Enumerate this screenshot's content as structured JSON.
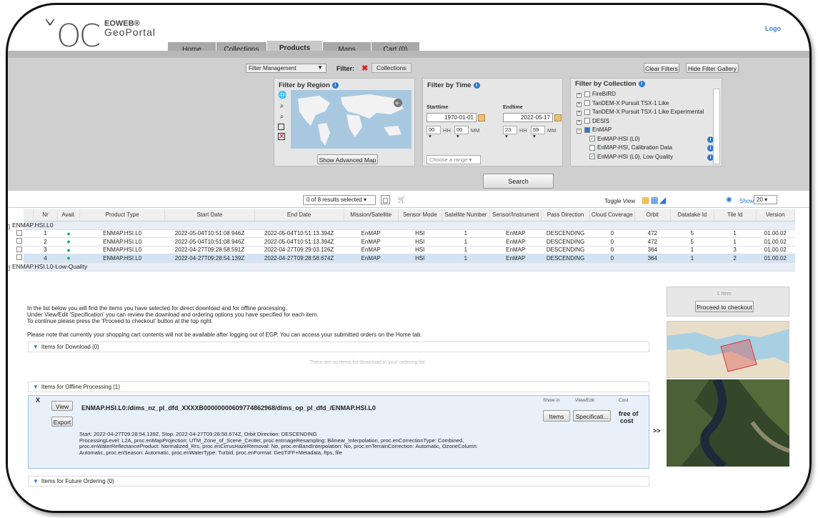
{
  "header": {
    "logo_mark": "OC",
    "logo_line1": "EOWEB®",
    "logo_line2": "GeoPortal",
    "login": "Logo"
  },
  "tabs": [
    "Home",
    "Collections",
    "Products",
    "Maps",
    "Cart (0)"
  ],
  "filter_bar": {
    "management": "Filter Management",
    "filter_label": "Filter:",
    "collections_btn": "Collections",
    "clear_filters": "Clear Filters",
    "hide_gallery": "Hide Filter Gallery"
  },
  "region": {
    "title": "Filter by Region",
    "adv_map": "Show Advanced Map"
  },
  "time": {
    "title": "Filter by Time",
    "start_label": "Starttime",
    "start_date": "1970-01-01",
    "end_label": "Endtime",
    "end_date": "2022-05-17",
    "start_h": "00",
    "start_m": "00",
    "end_h": "23",
    "end_m": "59",
    "hh": "HH",
    "mm": "MM",
    "range_placeholder": "Choose a range"
  },
  "collection": {
    "title": "Filter by Collection",
    "items": [
      {
        "label": "FireBIRD",
        "type": "plus"
      },
      {
        "label": "TanDEM-X Pursuit TSX-1 Like",
        "type": "plus"
      },
      {
        "label": "TanDEM-X Pursuit TSX-1 Like Experimental",
        "type": "plus"
      },
      {
        "label": "DESIS",
        "type": "plus"
      },
      {
        "label": "EnMAP",
        "type": "minus"
      },
      {
        "label": "EnMAP-HSI (L0)",
        "type": "checked"
      },
      {
        "label": "EnMAP-HSI, Calibration Data",
        "type": "unchecked"
      },
      {
        "label": "EnMAP-HSI (L0), Low Quality",
        "type": "checked"
      }
    ]
  },
  "search_btn": "Search",
  "results_bar": {
    "selected": "0 of 8 results selected",
    "toggle_view": "Toggle View",
    "show_items": "Show items :",
    "show_items_val": "20"
  },
  "table": {
    "headers": [
      "Nr",
      "Avail.",
      "Product Type",
      "Start Date",
      "End Date",
      "Mission/Satellite",
      "Sensor Mode",
      "Satellite Number",
      "Sensor/Instrument",
      "Pass Direction",
      "Cloud Coverage",
      "Orbit",
      "Datatake Id",
      "Tile Id",
      "Version"
    ],
    "group1": "ENMAP.HSI.L0",
    "group2": "ENMAP.HSI.L0-Low-Quality",
    "rows": [
      [
        "1",
        "ENMAP.HSI.L0",
        "2022-05-04T10:51:08.946Z",
        "2022-05-04T10:51:13.394Z",
        "EnMAP",
        "HSI",
        "1",
        "EnMAP",
        "DESCENDING",
        "0",
        "472",
        "5",
        "1",
        "01.00.02"
      ],
      [
        "2",
        "ENMAP.HSI.L0",
        "2022-05-04T10:51:08.946Z",
        "2022-05-04T10:51:13.394Z",
        "EnMAP",
        "HSI",
        "1",
        "EnMAP",
        "DESCENDING",
        "0",
        "472",
        "5",
        "1",
        "01.00.02"
      ],
      [
        "3",
        "ENMAP.HSI.L0",
        "2022-04-27T09:28:58.591Z",
        "2022-04-27T09:29:03.126Z",
        "EnMAP",
        "HSI",
        "1",
        "EnMAP",
        "DESCENDING",
        "0",
        "364",
        "1",
        "3",
        "01.00.02"
      ],
      [
        "4",
        "ENMAP.HSI.L0",
        "2022-04-27T09:28:54.139Z",
        "2022-04-27T09:28:58.674Z",
        "EnMAP",
        "HSI",
        "1",
        "EnMAP",
        "DESCENDING",
        "0",
        "364",
        "1",
        "2",
        "01.00.02"
      ]
    ]
  },
  "cart": {
    "intro_l1": "In the list below you will find the items you have selected for direct download and for offline processing.",
    "intro_l2": "Under View/Edit 'Specification' you can review the download and ordering options you have specified for each item.",
    "intro_l3": "To continue please press the 'Proceed to checkout' button at the top right.",
    "intro_l4": "Please note that currently your shopping cart contents will not be available after logging out of EGP. You can access your submitted orders on the Home tab.",
    "download_section": "Items for Download (0)",
    "download_empty": "There are no items for download in your ordering list",
    "offline_section": "Items for Offline Processing (1)",
    "future_section": "Items for Future Ordering (0)",
    "x": "X",
    "view_btn": "View",
    "export_btn": "Export",
    "item_title": "ENMAP.HSI.L0:/dims_nz_pl_dfd_XXXXB00000000609774862968/dims_op_pl_dfd_/ENMAP.HSI.L0",
    "show_in": "Show in",
    "view_edit": "View/Edit",
    "cost_lbl": "Cost",
    "items_btn": "Items",
    "spec_btn": "Specificati...",
    "free_l1": "free of",
    "free_l2": "cost",
    "detail_l1": "Start: 2022-04-27T09:28:54.139Z, Stop: 2022-04-27T09:28:58.674Z, Orbit Direction: DESCENDING",
    "detail_l2": "ProcessingLevel: L2A, proc.enMapProjection: UTM_Zone_of_Scene_Center, proc.enImageResampling: Bilinear_Interpolation, proc.enCorrectionType: Combined,",
    "detail_l3": "proc.enWaterReflectanceProduct: Normalized_Rrs, proc.enCirrusHazeRemoval: No, proc.enBandInterpolation: No, proc.enTerrainCorrection: Automatic, OzoneColumn:",
    "detail_l4": "Automatic, proc.enSeason: Automatic, proc.enWaterType: Turbid, proc.enFormat: GeoTIFF+Metadata, ftps, file",
    "count": "1 Item",
    "checkout": "Proceed to checkout",
    "expand": ">>"
  }
}
